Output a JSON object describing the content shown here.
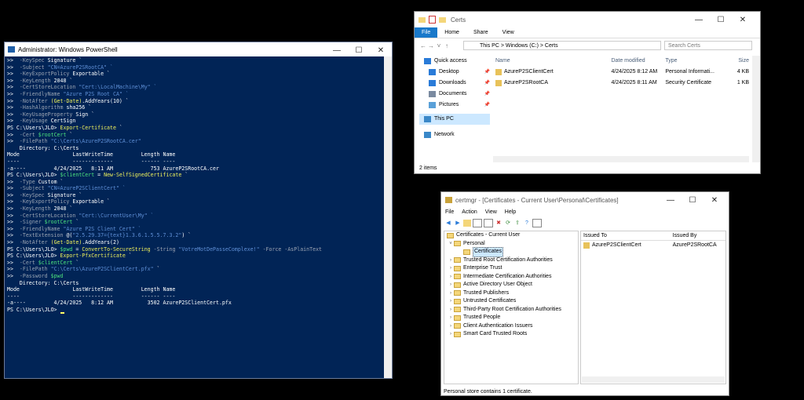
{
  "powershell": {
    "title": "Administrator: Windows PowerShell",
    "lines": [
      [
        [
          ">>  ",
          "w"
        ],
        [
          "-KeySpec ",
          "g"
        ],
        [
          "Signature `",
          "w"
        ]
      ],
      [
        [
          ">>  ",
          "w"
        ],
        [
          "-Subject ",
          "g"
        ],
        [
          "\"CN=AzureP2SRootCA\" `",
          "s"
        ]
      ],
      [
        [
          ">>  ",
          "w"
        ],
        [
          "-KeyExportPolicy ",
          "g"
        ],
        [
          "Exportable `",
          "w"
        ]
      ],
      [
        [
          ">>  ",
          "w"
        ],
        [
          "-KeyLength ",
          "g"
        ],
        [
          "2048 `",
          "w"
        ]
      ],
      [
        [
          ">>  ",
          "w"
        ],
        [
          "-CertStoreLocation ",
          "g"
        ],
        [
          "\"Cert:\\LocalMachine\\My\" `",
          "s"
        ]
      ],
      [
        [
          ">>  ",
          "w"
        ],
        [
          "-FriendlyName ",
          "g"
        ],
        [
          "\"Azure P2S Root CA\" `",
          "s"
        ]
      ],
      [
        [
          ">>  ",
          "w"
        ],
        [
          "-NotAfter ",
          "g"
        ],
        [
          "(Get-Date)",
          "y"
        ],
        [
          ".AddYears(10) `",
          "w"
        ]
      ],
      [
        [
          ">>  ",
          "w"
        ],
        [
          "-HashAlgorithm ",
          "g"
        ],
        [
          "sha256 `",
          "w"
        ]
      ],
      [
        [
          ">>  ",
          "w"
        ],
        [
          "-KeyUsageProperty ",
          "g"
        ],
        [
          "Sign `",
          "w"
        ]
      ],
      [
        [
          ">>  ",
          "w"
        ],
        [
          "-KeyUsage ",
          "g"
        ],
        [
          "CertSign",
          "w"
        ]
      ],
      [
        [
          "PS C:\\Users\\JLO> ",
          "w"
        ],
        [
          "Export-Certificate ",
          "y"
        ],
        [
          "`",
          "w"
        ]
      ],
      [
        [
          ">>  ",
          "w"
        ],
        [
          "-Cert ",
          "g"
        ],
        [
          "$rootCert ",
          "n"
        ],
        [
          "`",
          "w"
        ]
      ],
      [
        [
          ">>  ",
          "w"
        ],
        [
          "-FilePath ",
          "g"
        ],
        [
          "\"C:\\Certs\\AzureP2SRootCA.cer\"",
          "s"
        ]
      ],
      [
        [
          "",
          "w"
        ]
      ],
      [
        [
          "",
          "w"
        ]
      ],
      [
        [
          "    Directory: C:\\Certs",
          "w"
        ]
      ],
      [
        [
          "",
          "w"
        ]
      ],
      [
        [
          "",
          "w"
        ]
      ],
      [
        [
          "Mode                 LastWriteTime         Length Name",
          "w"
        ]
      ],
      [
        [
          "----                 -------------         ------ ----",
          "w"
        ]
      ],
      [
        [
          "-a----         4/24/2025   8:11 AM            753 AzureP2SRootCA.cer",
          "w"
        ]
      ],
      [
        [
          "",
          "w"
        ]
      ],
      [
        [
          "",
          "w"
        ]
      ],
      [
        [
          "PS C:\\Users\\JLO> ",
          "w"
        ],
        [
          "$clientCert ",
          "n"
        ],
        [
          "= ",
          "w"
        ],
        [
          "New-SelfSignedCertificate ",
          "y"
        ],
        [
          "`",
          "w"
        ]
      ],
      [
        [
          ">>  ",
          "w"
        ],
        [
          "-Type ",
          "g"
        ],
        [
          "Custom `",
          "w"
        ]
      ],
      [
        [
          ">>  ",
          "w"
        ],
        [
          "-Subject ",
          "g"
        ],
        [
          "\"CN=AzureP2SClientCert\" `",
          "s"
        ]
      ],
      [
        [
          ">>  ",
          "w"
        ],
        [
          "-KeySpec ",
          "g"
        ],
        [
          "Signature `",
          "w"
        ]
      ],
      [
        [
          ">>  ",
          "w"
        ],
        [
          "-KeyExportPolicy ",
          "g"
        ],
        [
          "Exportable `",
          "w"
        ]
      ],
      [
        [
          ">>  ",
          "w"
        ],
        [
          "-KeyLength ",
          "g"
        ],
        [
          "2048 `",
          "w"
        ]
      ],
      [
        [
          ">>  ",
          "w"
        ],
        [
          "-CertStoreLocation ",
          "g"
        ],
        [
          "\"Cert:\\CurrentUser\\My\" `",
          "s"
        ]
      ],
      [
        [
          ">>  ",
          "w"
        ],
        [
          "-Signer ",
          "g"
        ],
        [
          "$rootCert ",
          "n"
        ],
        [
          "`",
          "w"
        ]
      ],
      [
        [
          ">>  ",
          "w"
        ],
        [
          "-FriendlyName ",
          "g"
        ],
        [
          "\"Azure P2S Client Cert\" `",
          "s"
        ]
      ],
      [
        [
          ">>  ",
          "w"
        ],
        [
          "-TextExtension ",
          "g"
        ],
        [
          "@(",
          "w"
        ],
        [
          "\"2.5.29.37={text}1.3.6.1.5.5.7.3.2\"",
          "s"
        ],
        [
          ") `",
          "w"
        ]
      ],
      [
        [
          ">>  ",
          "w"
        ],
        [
          "-NotAfter ",
          "g"
        ],
        [
          "(Get-Date)",
          "y"
        ],
        [
          ".AddYears(2)",
          "w"
        ]
      ],
      [
        [
          "PS C:\\Users\\JLO> ",
          "w"
        ],
        [
          "$pwd ",
          "n"
        ],
        [
          "= ",
          "w"
        ],
        [
          "ConvertTo-SecureString ",
          "y"
        ],
        [
          "-String ",
          "g"
        ],
        [
          "\"VotreMotDePasseComplexe!\" ",
          "s"
        ],
        [
          "-Force -AsPlainText",
          "g"
        ]
      ],
      [
        [
          "PS C:\\Users\\JLO> ",
          "w"
        ],
        [
          "Export-PfxCertificate ",
          "y"
        ],
        [
          "`",
          "w"
        ]
      ],
      [
        [
          ">>  ",
          "w"
        ],
        [
          "-Cert ",
          "g"
        ],
        [
          "$clientCert ",
          "n"
        ],
        [
          "`",
          "w"
        ]
      ],
      [
        [
          ">>  ",
          "w"
        ],
        [
          "-FilePath ",
          "g"
        ],
        [
          "\"C:\\Certs\\AzureP2SClientCert.pfx\" ",
          "s"
        ],
        [
          "`",
          "w"
        ]
      ],
      [
        [
          ">>  ",
          "w"
        ],
        [
          "-Password ",
          "g"
        ],
        [
          "$pwd",
          "n"
        ]
      ],
      [
        [
          "",
          "w"
        ]
      ],
      [
        [
          "",
          "w"
        ]
      ],
      [
        [
          "    Directory: C:\\Certs",
          "w"
        ]
      ],
      [
        [
          "",
          "w"
        ]
      ],
      [
        [
          "",
          "w"
        ]
      ],
      [
        [
          "Mode                 LastWriteTime         Length Name",
          "w"
        ]
      ],
      [
        [
          "----                 -------------         ------ ----",
          "w"
        ]
      ],
      [
        [
          "-a----         4/24/2025   8:12 AM           3502 AzureP2SClientCert.pfx",
          "w"
        ]
      ],
      [
        [
          "",
          "w"
        ]
      ],
      [
        [
          "",
          "w"
        ]
      ],
      [
        [
          "PS C:\\Users\\JLO> ",
          "w"
        ]
      ]
    ]
  },
  "explorer": {
    "title": "Certs",
    "ribbon_tabs": [
      "File",
      "Home",
      "Share",
      "View"
    ],
    "breadcrumb": [
      "This PC",
      "Windows (C:)",
      "Certs"
    ],
    "search_placeholder": "Search Certs",
    "nav": [
      {
        "label": "Quick access",
        "icon": "star-icon",
        "color": "#2a7bd8"
      },
      {
        "label": "Desktop",
        "icon": "desktop-icon",
        "color": "#2a7bd8",
        "pinned": true
      },
      {
        "label": "Downloads",
        "icon": "download-icon",
        "color": "#2a7bd8",
        "pinned": true
      },
      {
        "label": "Documents",
        "icon": "documents-icon",
        "color": "#7a8aa0",
        "pinned": true
      },
      {
        "label": "Pictures",
        "icon": "pictures-icon",
        "color": "#5aa0d8",
        "pinned": true
      },
      {
        "label": "This PC",
        "icon": "computer-icon",
        "color": "#3a88c8",
        "selected": true
      },
      {
        "label": "Network",
        "icon": "network-icon",
        "color": "#3a88c8"
      }
    ],
    "columns": [
      "Name",
      "Date modified",
      "Type",
      "Size"
    ],
    "files": [
      {
        "name": "AzureP2SClientCert",
        "date": "4/24/2025 8:12 AM",
        "type": "Personal Informati...",
        "size": "4 KB",
        "icon": "pfx-file-icon"
      },
      {
        "name": "AzureP2SRootCA",
        "date": "4/24/2025 8:11 AM",
        "type": "Security Certificate",
        "size": "1 KB",
        "icon": "certificate-file-icon"
      }
    ],
    "status": "2 items"
  },
  "certmgr": {
    "title": "certmgr - [Certificates - Current User\\Personal\\Certificates]",
    "menu": [
      "File",
      "Action",
      "View",
      "Help"
    ],
    "tree_root": "Certificates - Current User",
    "tree_personal": "Personal",
    "tree_selected": "Certificates",
    "tree_items": [
      "Trusted Root Certification Authorities",
      "Enterprise Trust",
      "Intermediate Certification Authorities",
      "Active Directory User Object",
      "Trusted Publishers",
      "Untrusted Certificates",
      "Third-Party Root Certification Authorities",
      "Trusted People",
      "Client Authentication Issuers",
      "Smart Card Trusted Roots"
    ],
    "list_columns": [
      "Issued To",
      "Issued By"
    ],
    "certs": [
      {
        "issued_to": "AzureP2SClientCert",
        "issued_by": "AzureP2SRootCA"
      }
    ],
    "status": "Personal store contains 1 certificate."
  },
  "colors": {
    "console_bg": "#012456",
    "accent": "#1979ca",
    "folder": "#f4d67a"
  }
}
